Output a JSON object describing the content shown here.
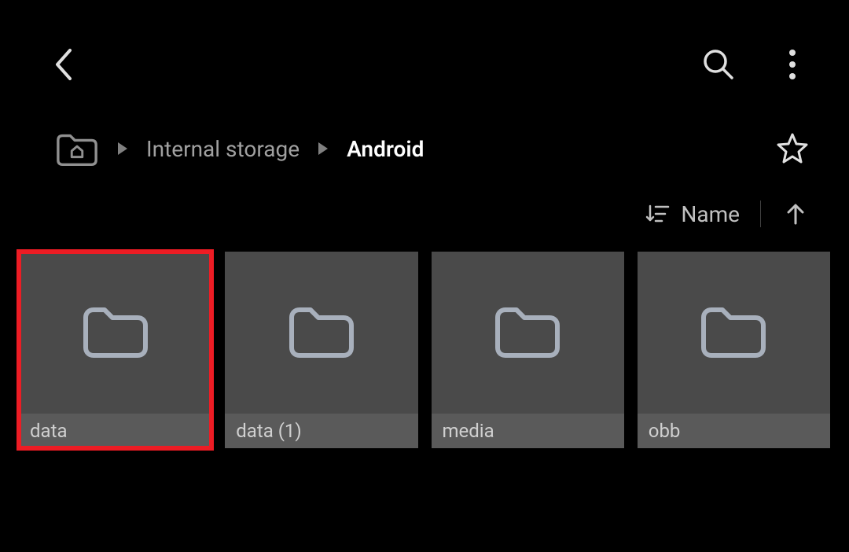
{
  "breadcrumb": {
    "items": [
      {
        "label": "Internal storage"
      }
    ],
    "current": "Android"
  },
  "sort": {
    "label": "Name"
  },
  "folders": [
    {
      "name": "data",
      "highlighted": true
    },
    {
      "name": "data (1)",
      "highlighted": false
    },
    {
      "name": "media",
      "highlighted": false
    },
    {
      "name": "obb",
      "highlighted": false
    }
  ]
}
